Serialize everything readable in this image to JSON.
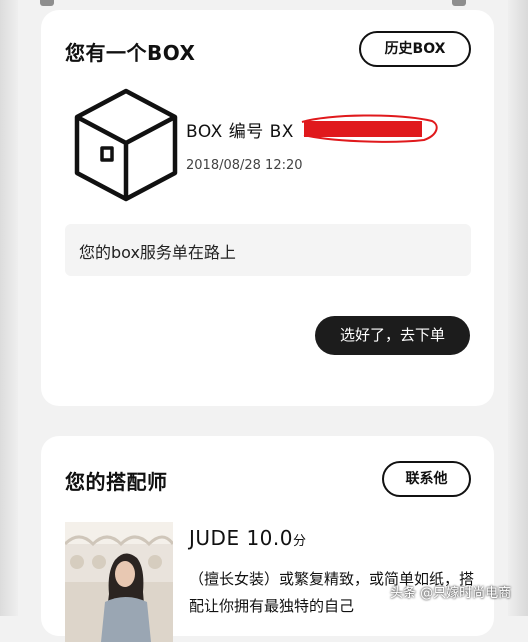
{
  "box_card": {
    "title": "您有一个BOX",
    "history_button": "历史BOX",
    "box_number_label": "BOX 编号 BX",
    "date": "2018/08/28 12:20",
    "status_text": "您的box服务单在路上",
    "cta_button": "选好了，去下单"
  },
  "stylist_card": {
    "title": "您的搭配师",
    "contact_button": "联系他",
    "name": "JUDE",
    "score": "10.0",
    "score_unit": "分",
    "description": "（擅长女装）或繁复精致，或简单如纸，搭配让你拥有最独特的自己"
  },
  "watermark": "头条 @只嫁时尚电商",
  "colors": {
    "page_background": "#f2f2f2",
    "card_background": "#ffffff",
    "cta_background": "#1c1c1c",
    "redaction_red": "#e0191c"
  },
  "icons": {
    "box": "box-icon",
    "redaction": "red-scribble-redaction"
  }
}
